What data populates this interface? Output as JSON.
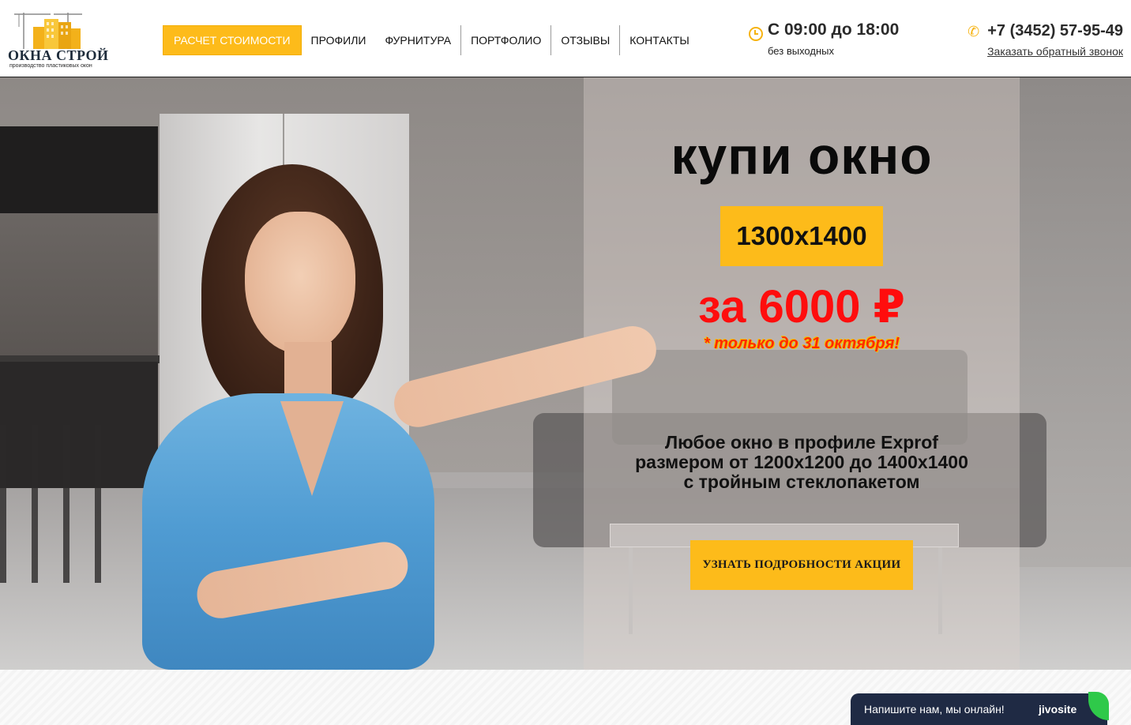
{
  "header": {
    "logo": {
      "title": "ОКНА СТРОЙ",
      "subtitle": "производство пластиковых окон"
    },
    "nav": [
      {
        "label": "РАСЧЕТ СТОИМОСТИ",
        "active": true
      },
      {
        "label": "ПРОФИЛИ"
      },
      {
        "label": "ФУРНИТУРА"
      },
      {
        "label": "ПОРТФОЛИО"
      },
      {
        "label": "ОТЗЫВЫ"
      },
      {
        "label": "КОНТАКТЫ"
      }
    ],
    "hours": {
      "main": "С 09:00 до 18:00",
      "sub": "без выходных",
      "icon": "clock-icon"
    },
    "phone": {
      "number": "+7 (3452) 57-95-49",
      "icon": "phone-icon",
      "callback": "Заказать обратный звонок"
    }
  },
  "hero": {
    "title": "купи окно",
    "size": "1300x1400",
    "price": "за 6000 ₽",
    "until": "* только до 31 октября!",
    "description": [
      "Любое окно в профиле Exprof",
      "размером от 1200x1200 до 1400x1400",
      "с тройным стеклопакетом"
    ],
    "cta": "УЗНАТЬ ПОДРОБНОСТИ АКЦИИ"
  },
  "chat": {
    "text": "Напишите нам, мы онлайн!",
    "brand": "jivosite"
  },
  "colors": {
    "accent": "#fdbb1a",
    "price": "#ff0d0d",
    "chat_bg": "#1f2a44",
    "chat_leaf": "#2fc94a"
  }
}
